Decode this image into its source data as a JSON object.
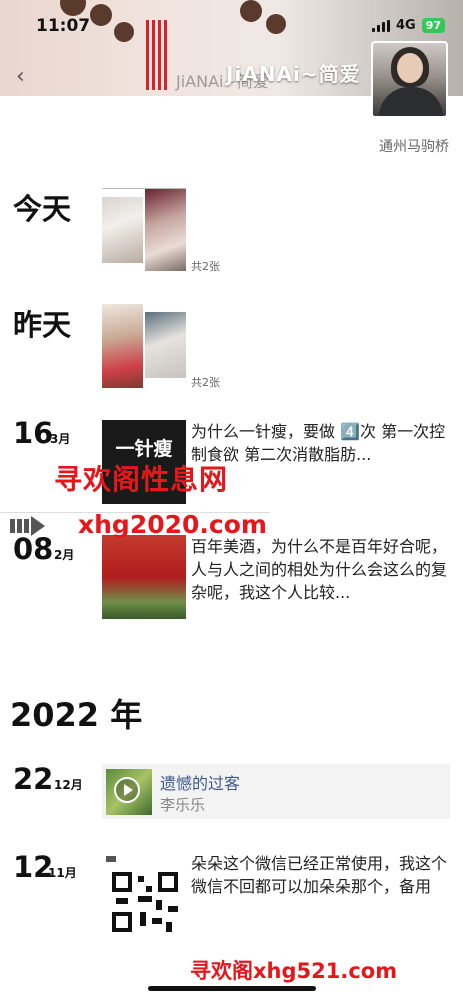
{
  "status_bar": {
    "time": "11:07",
    "network": "4G",
    "battery": "97"
  },
  "header": {
    "nickname": "JiANAi~简爱",
    "nickname_ghost": "JiANAi~简爱",
    "back_icon": "chevron-left-icon",
    "location": "通州马驹桥"
  },
  "feed": {
    "today": {
      "label": "今天",
      "count": "共2张"
    },
    "yesterday": {
      "label": "昨天",
      "count": "共2张"
    },
    "post_mar16": {
      "day": "16",
      "month": "3月",
      "thumb_title": "一针瘦",
      "text": "为什么一针瘦，要做 4️⃣次 第一次控制食欲 第二次消散脂肪..."
    },
    "post_feb08": {
      "day": "08",
      "month": "2月",
      "text": "百年美酒，为什么不是百年好合呢，人与人之间的相处为什么会这么的复杂呢，我这个人比较..."
    },
    "year_label": "2022 年",
    "post_dec22": {
      "day": "22",
      "month": "12月",
      "song_title": "遗憾的过客",
      "song_artist": "李乐乐"
    },
    "post_nov12": {
      "day": "12",
      "month": "11月",
      "text": "朵朵这个微信已经正常使用，我这个微信不回都可以加朵朵那个，备用"
    }
  },
  "watermarks": {
    "site1": "寻欢阁性息网",
    "site2": "xhg2020.com",
    "site3": "寻欢阁xhg521.com"
  },
  "colors": {
    "watermark": "#e6161b",
    "link": "#3d5a8a",
    "battery": "#35c759"
  }
}
